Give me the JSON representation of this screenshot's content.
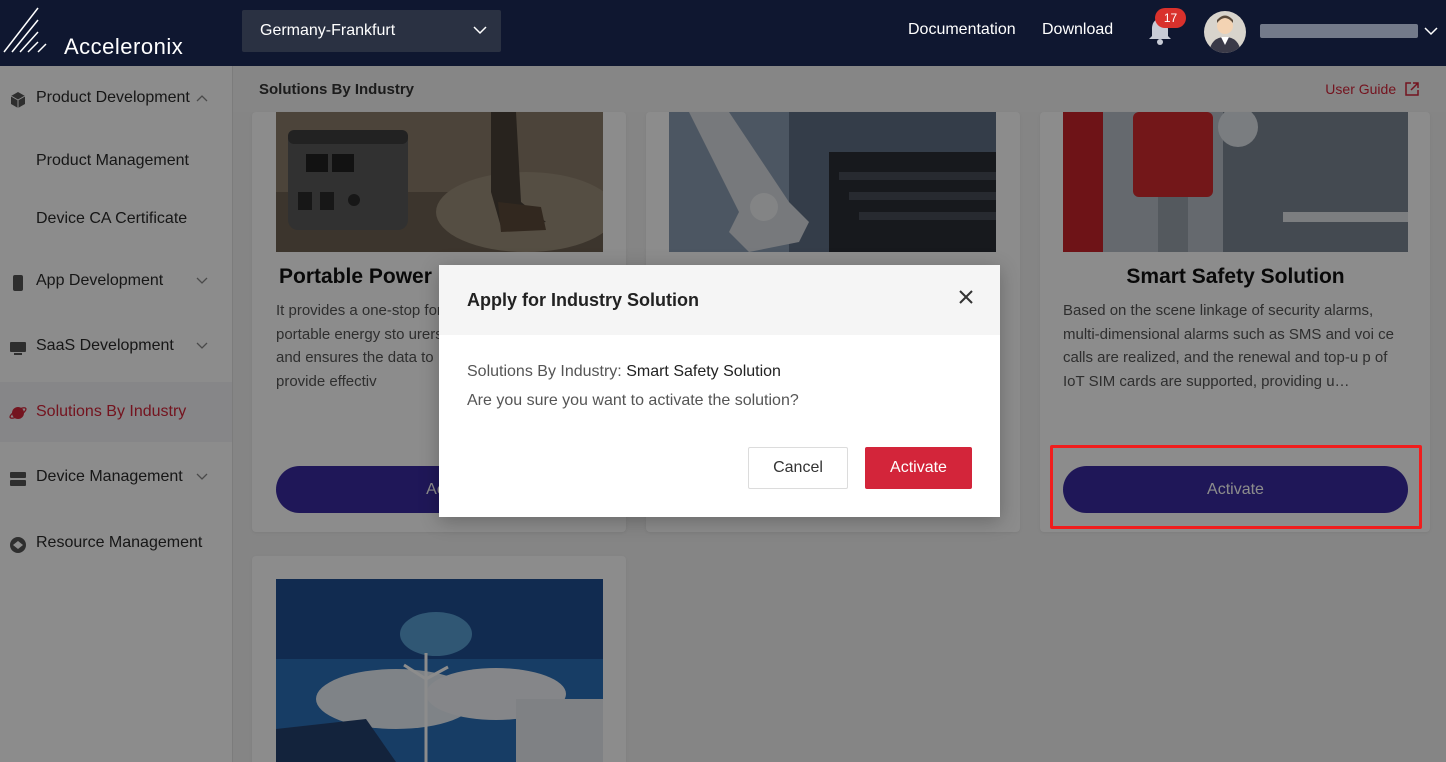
{
  "app": {
    "name": "Acceleronix",
    "region": "Germany-Frankfurt",
    "nav_links": [
      "Documentation",
      "Download"
    ],
    "notification_count": "17",
    "icons": {
      "logo": "logo-stripes-icon",
      "bell": "bell-icon",
      "avatar": "avatar-icon",
      "chevron": "chevron-down-icon"
    }
  },
  "sidebar": {
    "items": [
      {
        "label": "Product Development",
        "icon": "cube-icon",
        "expanded": true
      },
      {
        "label": "Product Management"
      },
      {
        "label": "Device CA Certificate"
      },
      {
        "label": "App Development",
        "icon": "phone-icon"
      },
      {
        "label": "SaaS Development",
        "icon": "monitor-icon"
      },
      {
        "label": "Solutions By Industry",
        "icon": "planet-icon",
        "active": true
      },
      {
        "label": "Device Management",
        "icon": "server-icon"
      },
      {
        "label": "Resource Management",
        "icon": "resource-icon"
      }
    ]
  },
  "content": {
    "title": "Solutions By Industry",
    "user_guide": "User Guide",
    "cards": [
      {
        "title": "Portable Power",
        "description": "It provides a one-stop for portable energy sto urers and ensures the data to provide effectiv",
        "button": "Acti"
      },
      {
        "title": "",
        "description": "",
        "button": ""
      },
      {
        "title": "Smart Safety Solution",
        "description": "Based on the scene linkage of security alarms, multi-dimensional alarms such as SMS and voi ce calls are realized, and the renewal and top-u p of IoT SIM cards are supported, providing u…",
        "button": "Activate"
      }
    ]
  },
  "modal": {
    "title": "Apply for Industry Solution",
    "line1_label": "Solutions By Industry:",
    "line1_value": "Smart Safety Solution",
    "line2": "Are you sure you want to activate the solution?",
    "cancel": "Cancel",
    "activate": "Activate",
    "colors": {
      "primary": "#d3253a",
      "activate_pill": "#3a2aa0",
      "highlight": "#f01d1d"
    }
  }
}
